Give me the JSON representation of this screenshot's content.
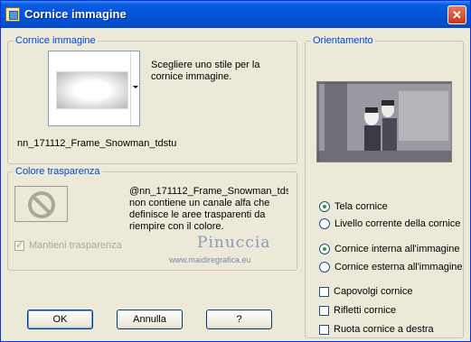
{
  "window": {
    "title": "Cornice immagine",
    "close_glyph": "✕"
  },
  "frame_group": {
    "legend": "Cornice immagine",
    "help": "Scegliere uno stile per la\ncornice immagine.",
    "selected_name": "nn_171112_Frame_Snowman_tdstuc"
  },
  "transparency_group": {
    "legend": "Colore trasparenza",
    "message": "@nn_171112_Frame_Snowman_tds\nnon contiene un canale alfa che\ndefinisce le aree trasparenti da\nriempire con il colore.",
    "keep_transparency": "Mantieni trasparenza",
    "swatch_icon": "no-symbol-icon"
  },
  "orientation_group": {
    "legend": "Orientamento",
    "canvas_options": [
      "Tela cornice",
      "Livello corrente della cornice"
    ],
    "placement_options": [
      "Cornice interna all'immagine",
      "Cornice esterna all'immagine"
    ],
    "checkboxes": [
      "Capovolgi cornice",
      "Rifletti cornice",
      "Ruota cornice a destra"
    ]
  },
  "buttons": {
    "ok": "OK",
    "cancel": "Annulla",
    "help": "?"
  },
  "watermark": {
    "name": "Pinuccia",
    "site": "www.maidiregrafica.eu"
  },
  "colors": {
    "title_bar": "#0454d8",
    "legend_text": "#0046d5",
    "dialog_bg": "#ece9d8"
  }
}
